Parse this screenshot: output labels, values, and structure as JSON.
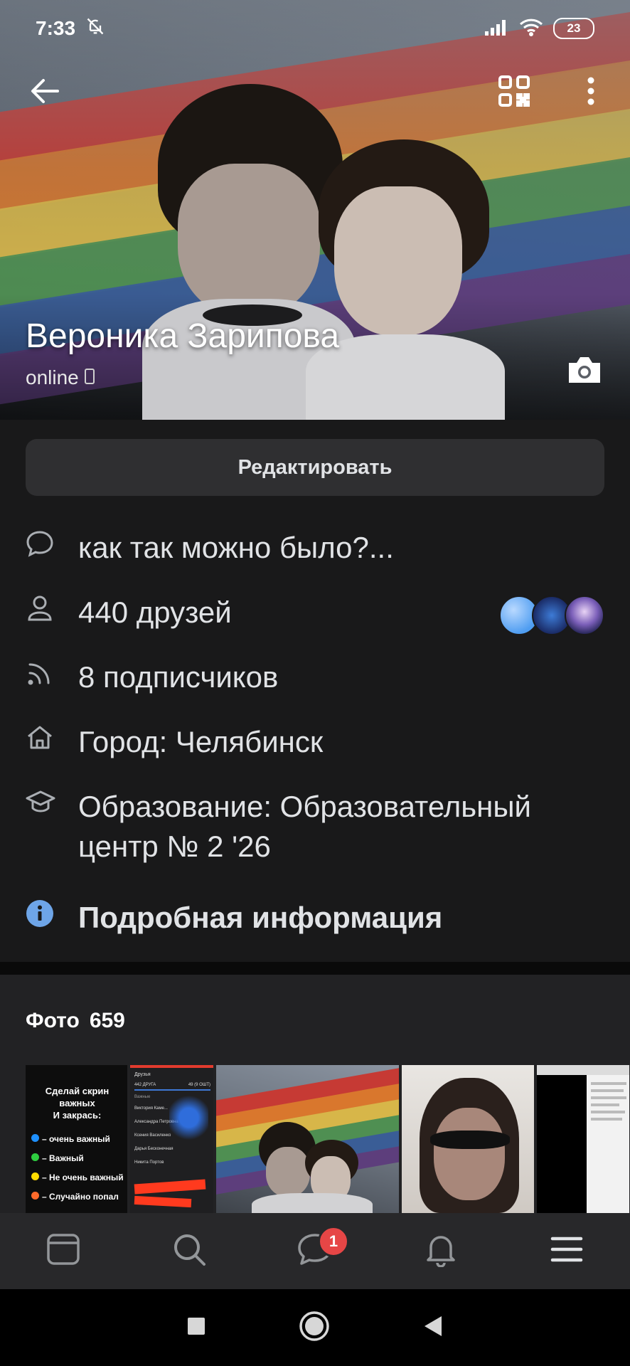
{
  "status_bar": {
    "time": "7:33",
    "battery": "23"
  },
  "profile": {
    "name": "Вероника Зарипова",
    "status": "online"
  },
  "actions": {
    "edit_label": "Редактировать"
  },
  "info_rows": {
    "status_text": "как так можно было?...",
    "friends": "440 друзей",
    "followers": "8 подписчиков",
    "city": "Город: Челябинск",
    "education_line1": "Образование: Образовательный",
    "education_line2": "центр № 2 '26",
    "details": "Подробная информация"
  },
  "photos": {
    "title": "Фото",
    "count": "659",
    "thumb1": {
      "title_line1": "Сделай скрин",
      "title_line2": "важных",
      "title_line3": "И закрась:",
      "item1": "– очень важный",
      "item2": "– Важный",
      "item3": "– Не очень важный",
      "item4": "– Случайно попал",
      "item1_color": "#1e90ff",
      "item2_color": "#2ecc40",
      "item3_color": "#ffdc00",
      "item4_color": "#ff6a2b"
    },
    "thumb2": {
      "header": "Друзья",
      "tab": "442 ДРУГА",
      "subtab": "49 (9 ОШТ)",
      "section": "Важные",
      "friend1": "Виктория Каме...",
      "friend2": "Александра Петровна",
      "friend3": "Ксения Василенко",
      "friend4": "Дарья Бесконечная",
      "friend5": "Никита Портов"
    }
  },
  "bottom_nav": {
    "messages_badge": "1"
  },
  "colors": {
    "background": "#19191a",
    "button": "#2f2f31",
    "accent_info": "#5181b8",
    "badge": "#e64646"
  },
  "icons": {
    "back": "back-arrow-icon",
    "qr": "qr-code-icon",
    "more": "more-vertical-icon",
    "camera": "camera-icon",
    "status": "speech-bubble-icon",
    "friends": "person-icon",
    "followers": "rss-icon",
    "city": "home-icon",
    "education": "graduation-cap-icon",
    "details": "info-icon",
    "feed": "feed-icon",
    "search": "search-icon",
    "messages": "chat-icon",
    "notifications": "bell-icon",
    "menu": "menu-icon"
  }
}
